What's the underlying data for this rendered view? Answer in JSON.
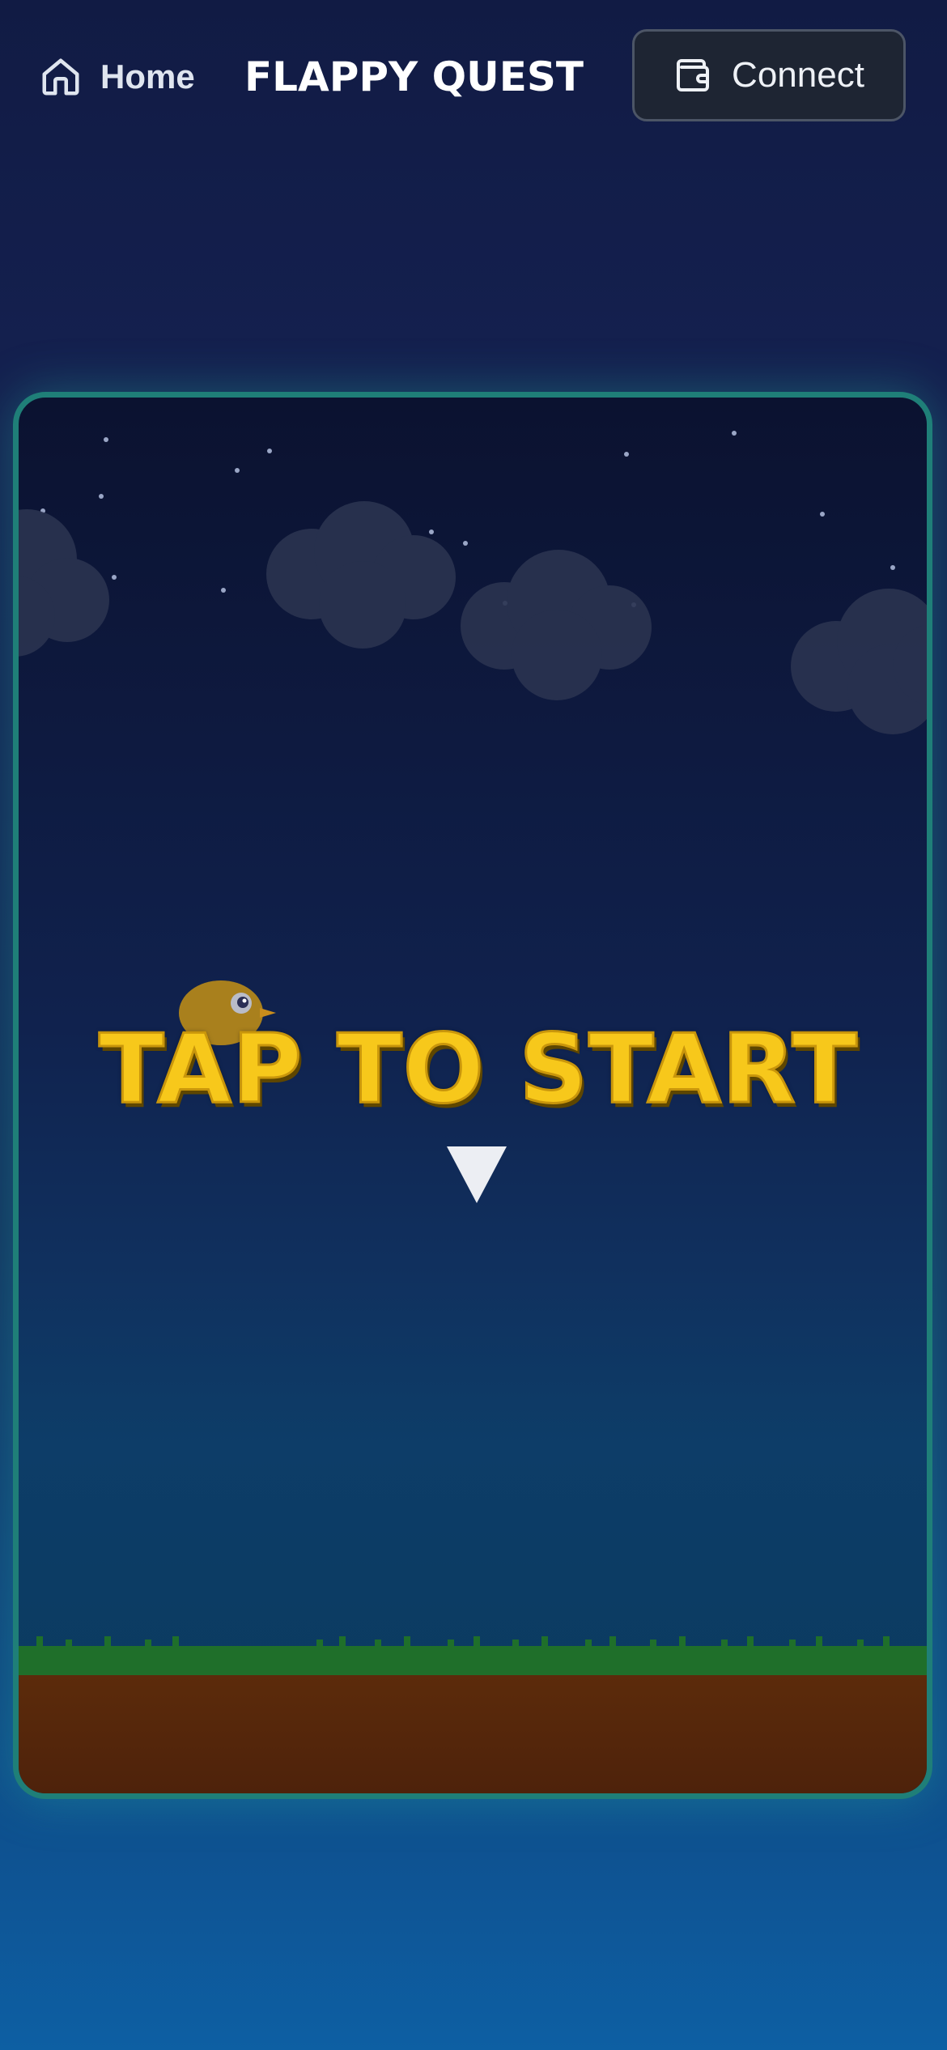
{
  "header": {
    "home_label": "Home",
    "title": "FLAPPY QUEST",
    "connect_label": "Connect"
  },
  "game": {
    "prompt_text": "TAP TO START"
  },
  "colors": {
    "accent_border": "#1f7f78",
    "prompt_yellow": "#f7c81b",
    "grass": "#1f6f2a",
    "dirt": "#5a2a0c",
    "bird": "#a07a1a"
  },
  "icons": {
    "home": "home-icon",
    "wallet": "wallet-icon",
    "arrow": "down-triangle-icon",
    "bird": "bird-sprite"
  }
}
